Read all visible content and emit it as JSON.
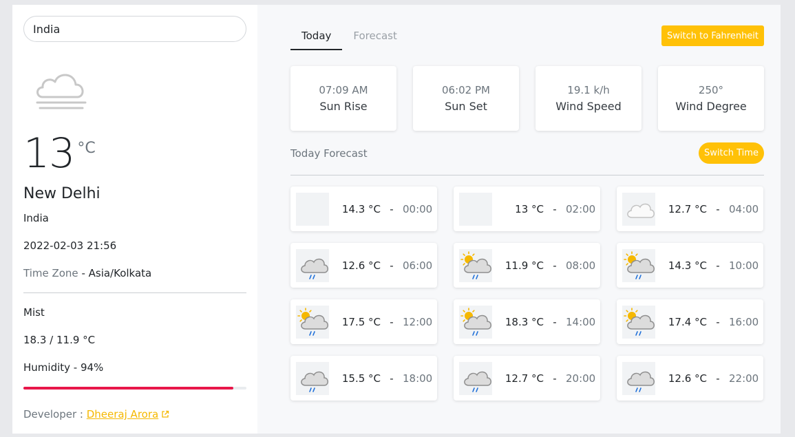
{
  "search": {
    "value": "India"
  },
  "current": {
    "temp": "13",
    "unit": "°C",
    "city": "New Delhi",
    "country": "India",
    "datetime": "2022-02-03 21:56",
    "timezone_label": "Time Zone",
    "timezone_sep": " - ",
    "timezone_value": "Asia/Kolkata",
    "condition": "Mist",
    "min_max": "18.3 / 11.9 °C",
    "humidity_text": "Humidity - 94%",
    "humidity_fraction": 0.94,
    "icon": "mist-cloud-icon"
  },
  "developer": {
    "label": "Developer : ",
    "name": "Dheeraj Arora"
  },
  "tabs": [
    {
      "label": "Today",
      "active": true
    },
    {
      "label": "Forecast",
      "active": false
    }
  ],
  "buttons": {
    "switch_unit": "Switch to Fahrenheit",
    "switch_time": "Switch Time"
  },
  "stats": [
    {
      "value": "07:09 AM",
      "label": "Sun Rise"
    },
    {
      "value": "06:02 PM",
      "label": "Sun Set"
    },
    {
      "value": "19.1 k/h",
      "label": "Wind Speed"
    },
    {
      "value": "250°",
      "label": "Wind Degree"
    }
  ],
  "today_forecast_title": "Today Forecast",
  "hourly": [
    {
      "icon": "moon-icon",
      "temp": "14.3 °C",
      "sep": "-",
      "time": "00:00"
    },
    {
      "icon": "moon-icon",
      "temp": "13 °C",
      "sep": "-",
      "time": "02:00"
    },
    {
      "icon": "moon-cloud-icon",
      "temp": "12.7 °C",
      "sep": "-",
      "time": "04:00"
    },
    {
      "icon": "moon-rain-icon",
      "temp": "12.6 °C",
      "sep": "-",
      "time": "06:00"
    },
    {
      "icon": "sun-rain-icon",
      "temp": "11.9 °C",
      "sep": "-",
      "time": "08:00"
    },
    {
      "icon": "sun-rain-icon",
      "temp": "14.3 °C",
      "sep": "-",
      "time": "10:00"
    },
    {
      "icon": "sun-rain-icon",
      "temp": "17.5 °C",
      "sep": "-",
      "time": "12:00"
    },
    {
      "icon": "sun-rain-icon",
      "temp": "18.3 °C",
      "sep": "-",
      "time": "14:00"
    },
    {
      "icon": "sun-rain-icon",
      "temp": "17.4 °C",
      "sep": "-",
      "time": "16:00"
    },
    {
      "icon": "moon-rain-icon",
      "temp": "15.5 °C",
      "sep": "-",
      "time": "18:00"
    },
    {
      "icon": "moon-rain-icon",
      "temp": "12.7 °C",
      "sep": "-",
      "time": "20:00"
    },
    {
      "icon": "moon-rain-icon",
      "temp": "12.6 °C",
      "sep": "-",
      "time": "22:00"
    }
  ],
  "colors": {
    "accent": "#ffc107",
    "humidity_bar": "#e8174a",
    "moon": "#1e6fd9",
    "sun": "#f5b800"
  }
}
